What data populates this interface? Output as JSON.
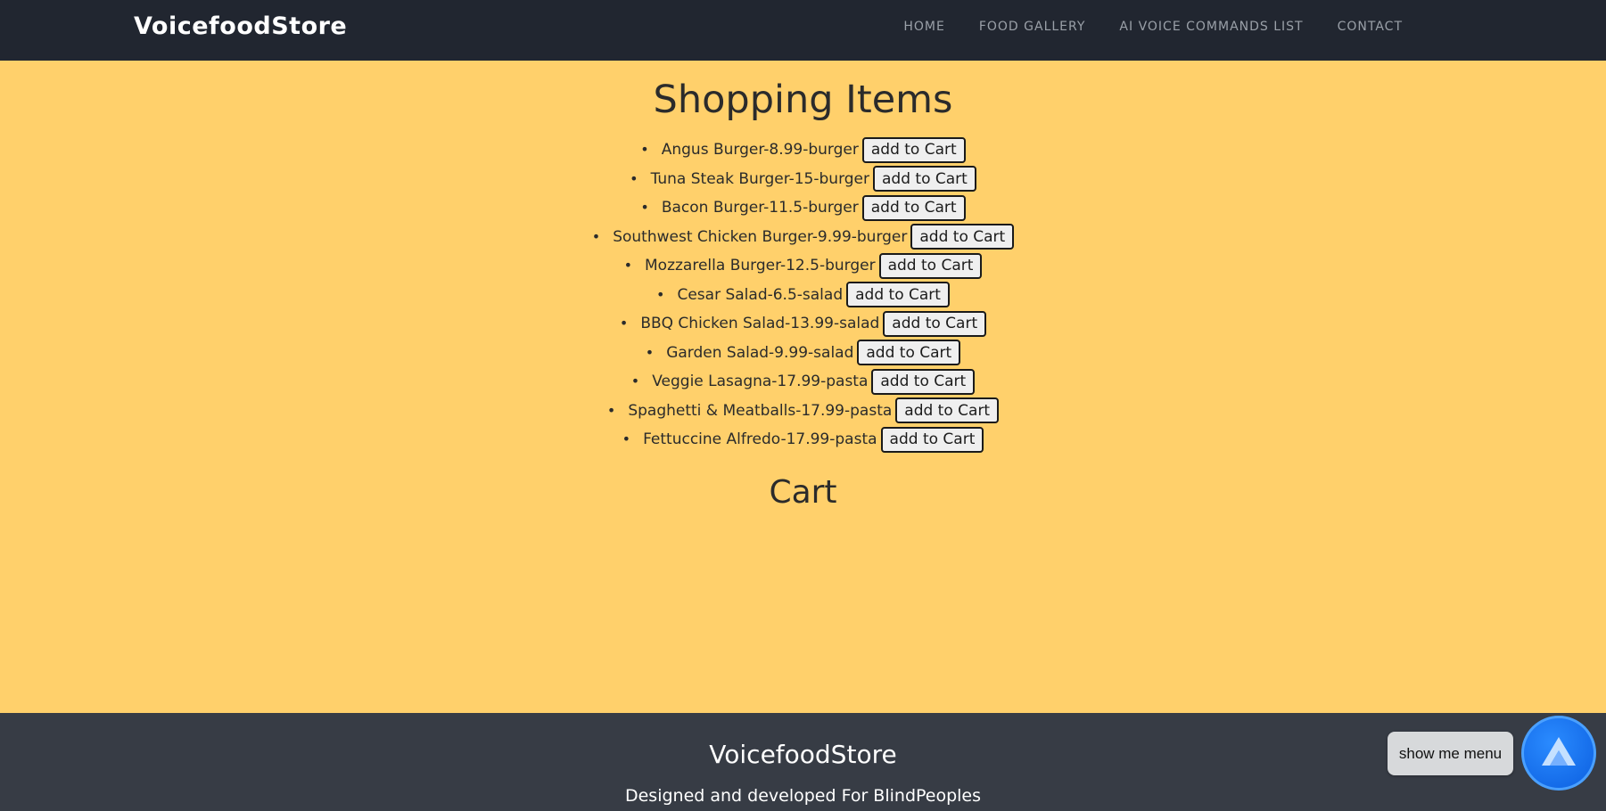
{
  "nav": {
    "brand": "VoicefoodStore",
    "links": [
      "HOME",
      "FOOD GALLERY",
      "AI VOICE COMMANDS LIST",
      "CONTACT"
    ]
  },
  "main": {
    "title": "Shopping Items",
    "items": [
      {
        "text": "Angus Burger-8.99-burger",
        "button": "add to Cart"
      },
      {
        "text": "Tuna Steak Burger-15-burger",
        "button": "add to Cart"
      },
      {
        "text": "Bacon Burger-11.5-burger",
        "button": "add to Cart"
      },
      {
        "text": "Southwest Chicken Burger-9.99-burger",
        "button": "add to Cart"
      },
      {
        "text": "Mozzarella Burger-12.5-burger",
        "button": "add to Cart"
      },
      {
        "text": "Cesar Salad-6.5-salad",
        "button": "add to Cart"
      },
      {
        "text": "BBQ Chicken Salad-13.99-salad",
        "button": "add to Cart"
      },
      {
        "text": "Garden Salad-9.99-salad",
        "button": "add to Cart"
      },
      {
        "text": "Veggie Lasagna-17.99-pasta",
        "button": "add to Cart"
      },
      {
        "text": "Spaghetti & Meatballs-17.99-pasta",
        "button": "add to Cart"
      },
      {
        "text": "Fettuccine Alfredo-17.99-pasta",
        "button": "add to Cart"
      }
    ],
    "cart_title": "Cart"
  },
  "footer": {
    "title": "VoicefoodStore",
    "subtitle": "Designed and developed For BlindPeoples"
  },
  "assistant": {
    "tooltip": "show me menu",
    "icon": "alan-ai-icon"
  },
  "colors": {
    "navbar": "#212630",
    "page_background": "#ffd06b",
    "footer": "#373c45",
    "assistant": "#0c5fe0"
  }
}
